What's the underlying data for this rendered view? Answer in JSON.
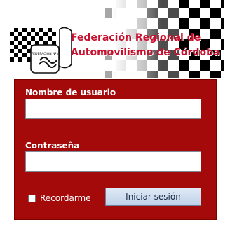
{
  "header": {
    "title_line1": "Federación Regional de",
    "title_line2": "Automovilismo de Córdoba",
    "logo_caption": "FEDERACION Nº1",
    "colors": {
      "title": "#c8102e",
      "checker_dark": "#000000",
      "checker_light": "#ffffff"
    }
  },
  "login": {
    "username_label": "Nombre de usuario",
    "username_value": "",
    "password_label": "Contraseña",
    "password_value": "",
    "remember_label": "Recordarme",
    "remember_checked": false,
    "submit_label": "Iniciar sesión",
    "colors": {
      "panel_background": "#a50a0a",
      "label_text": "#ffffff",
      "button_background": "#c9daf0"
    }
  }
}
